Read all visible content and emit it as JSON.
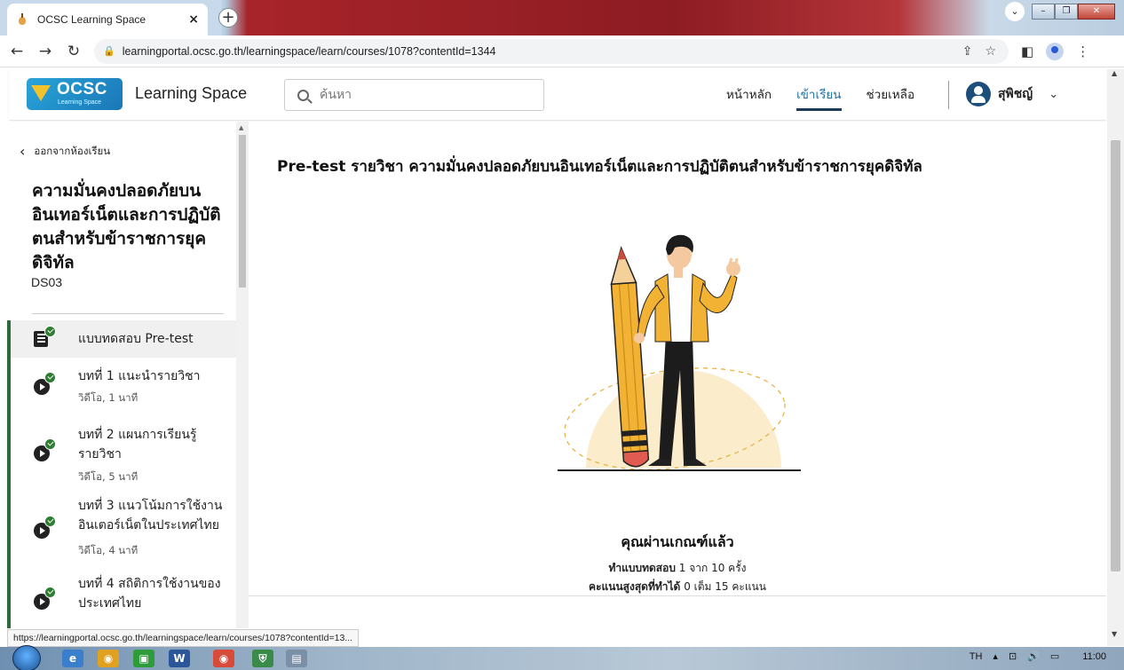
{
  "browser": {
    "tab_title": "OCSC Learning Space",
    "url": "learningportal.ocsc.go.th/learningspace/learn/courses/1078?contentId=1344",
    "status_url": "https://learningportal.ocsc.go.th/learningspace/learn/courses/1078?contentId=13..."
  },
  "header": {
    "logo_text": "OCSC",
    "logo_sub": "Learning Space",
    "brand": "Learning Space",
    "search_placeholder": "ค้นหา",
    "nav": [
      "หน้าหลัก",
      "เข้าเรียน",
      "ช่วยเหลือ"
    ],
    "active_nav": "เข้าเรียน",
    "user_name": "สุพิชญ์"
  },
  "sidebar": {
    "back_label": "ออกจากห้องเรียน",
    "course_title": "ความมั่นคงปลอดภัยบนอินเทอร์เน็ตและการปฏิบัติตนสำหรับข้าราชการยุคดิจิทัล",
    "course_code": "DS03",
    "lessons": [
      {
        "title": "แบบทดสอบ Pre-test",
        "sub": "",
        "icon": "document-icon",
        "done": true,
        "active": true
      },
      {
        "title": "บทที่ 1 แนะนำรายวิชา",
        "sub": "วิดีโอ, 1 นาที",
        "icon": "play-icon",
        "done": true,
        "active": false
      },
      {
        "title": "บทที่ 2 แผนการเรียนรู้รายวิชา",
        "sub": "วิดีโอ, 5 นาที",
        "icon": "play-icon",
        "done": true,
        "active": false
      },
      {
        "title": "บทที่ 3 แนวโน้มการใช้งานอินเตอร์เน็ตในประเทศไทย",
        "sub": "วิดีโอ, 4 นาที",
        "icon": "play-icon",
        "done": true,
        "active": false
      },
      {
        "title": "บทที่ 4 สถิติการใช้งานของประเทศไทย",
        "sub": "",
        "icon": "play-icon",
        "done": true,
        "active": false
      }
    ]
  },
  "main": {
    "title": "Pre-test รายวิชา ความมั่นคงปลอดภัยบนอินเทอร์เน็ตและการปฏิบัติตนสำหรับข้าราชการยุคดิจิทัล",
    "result_title": "คุณผ่านเกณฑ์แล้ว",
    "attempts_label": "ทำแบบทดสอบ",
    "attempts_value": "1 จาก 10 ครั้ง",
    "score_label": "คะแนนสูงสุดที่ทำได้",
    "score_value": "0 เต็ม 15 คะแนน"
  },
  "taskbar": {
    "lang": "TH",
    "time": "11:00"
  },
  "colors": {
    "accent": "#1c6ea4",
    "progress_bar": "#2e6b3a",
    "check": "#2e7d32",
    "illustration_yellow": "#f2b233"
  }
}
